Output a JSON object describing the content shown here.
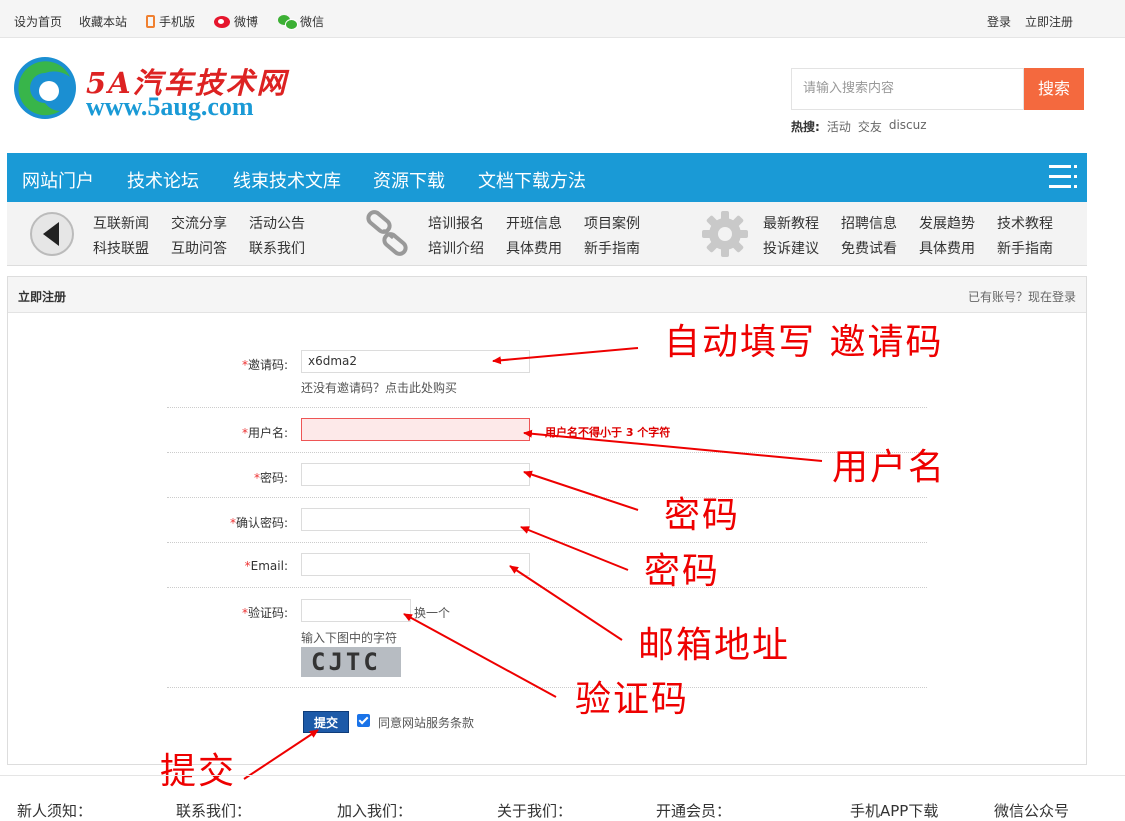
{
  "topbar": {
    "left": [
      "设为首页",
      "收藏本站",
      "手机版",
      "微博",
      "微信"
    ],
    "right": [
      "登录",
      "立即注册"
    ]
  },
  "header": {
    "logo_title": "5A汽车技术网",
    "logo_url": "www.5aug.com",
    "search_placeholder": "请输入搜索内容",
    "search_button": "搜索",
    "hot_label": "热搜:",
    "hot_items": [
      "活动",
      "交友",
      "discuz"
    ]
  },
  "nav": [
    "网站门户",
    "技术论坛",
    "线束技术文库",
    "资源下载",
    "文档下载方法"
  ],
  "subnav": {
    "group1": [
      "互联新闻",
      "交流分享",
      "活动公告",
      "科技联盟",
      "互助问答",
      "联系我们"
    ],
    "group2": [
      "培训报名",
      "开班信息",
      "项目案例",
      "培训介绍",
      "具体费用",
      "新手指南"
    ],
    "group3": [
      "最新教程",
      "招聘信息",
      "发展趋势",
      "技术教程",
      "投诉建议",
      "免费试看",
      "具体费用",
      "新手指南"
    ]
  },
  "panel": {
    "title": "立即注册",
    "login_link": "已有账号？现在登录"
  },
  "form": {
    "invite_label": "邀请码:",
    "invite_value": "x6dma2",
    "invite_hint": "还没有邀请码？点击此处购买",
    "username_label": "用户名:",
    "username_error": "用户名不得小于 3 个字符",
    "password_label": "密码:",
    "confirm_label": "确认密码:",
    "email_label": "Email:",
    "captcha_label": "验证码:",
    "captcha_refresh": "换一个",
    "captcha_hint": "输入下图中的字符",
    "captcha_text": "CJTC",
    "submit": "提交",
    "agree": "同意网站服务条款",
    "required_mark": "*"
  },
  "annotations": {
    "invite": "自动填写 邀请码",
    "username": "用户名",
    "password": "密码",
    "confirm": "密码",
    "email": "邮箱地址",
    "captcha": "验证码",
    "submit": "提交"
  },
  "footer": [
    "新人须知：",
    "联系我们：",
    "加入我们：",
    "关于我们：",
    "开通会员：",
    "手机APP下载",
    "微信公众号"
  ],
  "colors": {
    "brand_blue": "#1a9ad6",
    "search_orange": "#f4693e",
    "annotation_red": "#e00"
  }
}
